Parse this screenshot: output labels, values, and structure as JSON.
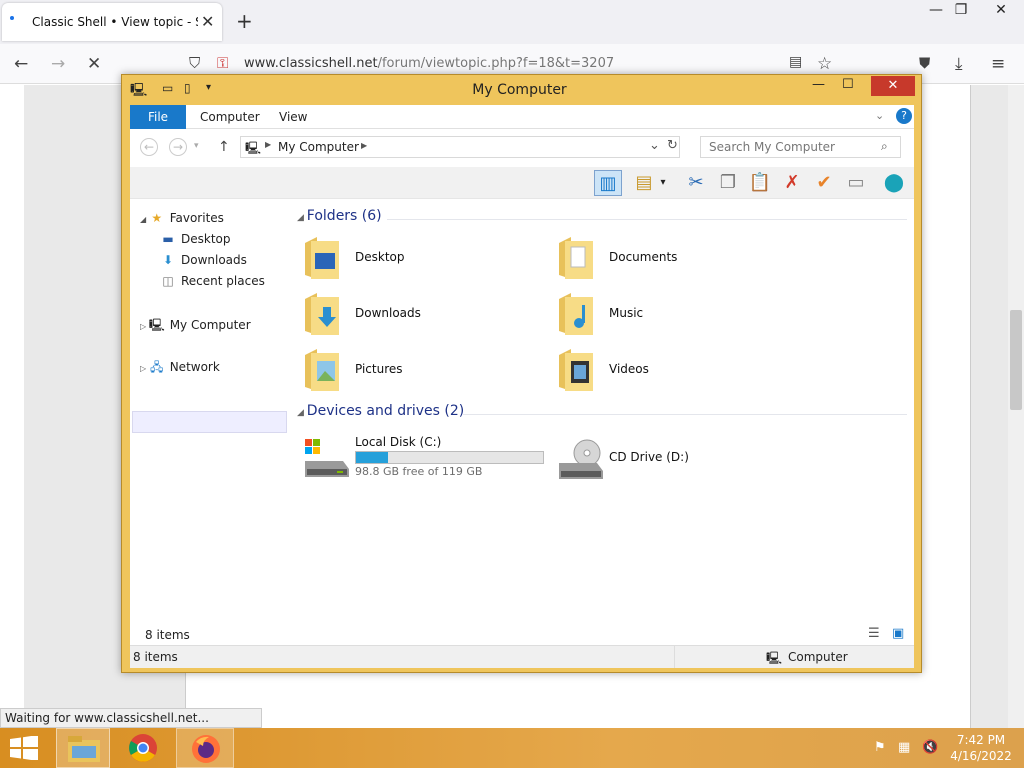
{
  "browser": {
    "tab_title": "Classic Shell • View topic - Start",
    "url_host": "www.classicshell.net",
    "url_path": "/forum/viewtopic.php?f=18&t=3207",
    "status": "Waiting for www.classicshell.net..."
  },
  "window": {
    "title": "My Computer",
    "ribbon_tabs": [
      "File",
      "Computer",
      "View"
    ],
    "address": "My Computer",
    "search_placeholder": "Search My Computer"
  },
  "nav": {
    "favorites": "Favorites",
    "items": [
      "Desktop",
      "Downloads",
      "Recent places"
    ],
    "mycomputer": "My Computer",
    "network": "Network"
  },
  "folders": {
    "header": "Folders (6)",
    "items": [
      "Desktop",
      "Documents",
      "Downloads",
      "Music",
      "Pictures",
      "Videos"
    ]
  },
  "devices": {
    "header": "Devices and drives (2)",
    "local_disk": {
      "name": "Local Disk (C:)",
      "free": "98.8 GB free of 119 GB",
      "used_fraction": 0.17
    },
    "cd": {
      "name": "CD Drive (D:)"
    }
  },
  "status": {
    "count_top": "8 items",
    "count_bottom": "8 items",
    "location": "Computer"
  },
  "taskbar": {
    "time": "7:42 PM",
    "date": "4/16/2022"
  },
  "colors": {
    "window_frame": "#efc55c",
    "file_tab": "#1979ca",
    "close": "#c7392b",
    "header_text": "#1e3287",
    "disk_bar": "#26a0da"
  }
}
